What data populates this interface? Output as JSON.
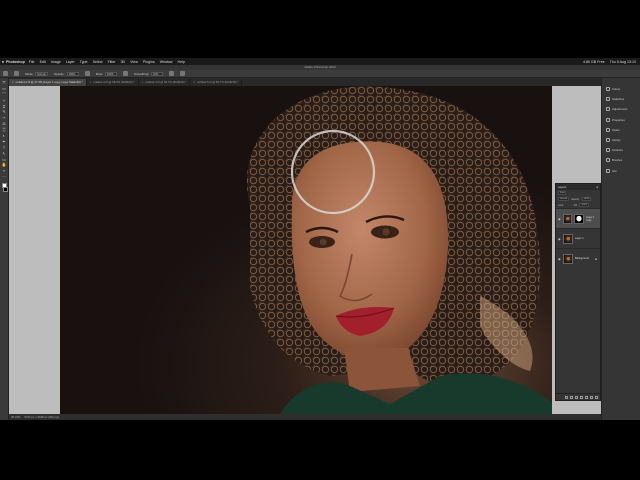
{
  "menubar": {
    "app_name": "Photoshop",
    "items": [
      "File",
      "Edit",
      "Image",
      "Layer",
      "Type",
      "Select",
      "Filter",
      "3D",
      "View",
      "Plugins",
      "Window",
      "Help"
    ],
    "status_right": [
      "4.80 GB Free",
      "Thu 8 Aug  13:10"
    ]
  },
  "window": {
    "title": "Adobe Photoshop 2024"
  },
  "options": {
    "mode_label": "Mode:",
    "mode_value": "Normal",
    "opacity_label": "Opacity:",
    "opacity_value": "100%",
    "flow_label": "Flow:",
    "flow_value": "100%",
    "smoothing_label": "Smoothing:",
    "smoothing_value": "10%"
  },
  "tabs": [
    {
      "label": "untitled-2.tif @ 47.3% (Layer 1 copy, Layer Mask/16) *",
      "active": true
    },
    {
      "label": "untitled-3.tif @ 58.3% (RGB/16) *",
      "active": false
    },
    {
      "label": "untitled-4.tif @ 56.7% (RGB/16) *",
      "active": false
    },
    {
      "label": "untitled-5.tif @ 56.7% (RGB/16) *",
      "active": false
    }
  ],
  "tools": [
    "⤧",
    "▭",
    "⌒",
    "✧",
    "⌗",
    "✎",
    "✑",
    "⎌",
    "▒",
    "◐",
    "✒",
    "T",
    "↖",
    "▭",
    "✋",
    "⌕",
    "⋯"
  ],
  "statusbar": {
    "zoom": "45.33%",
    "doc": "5472 px x 3648 px (300 ppi)"
  },
  "panels": {
    "items": [
      {
        "label": "Colour",
        "icon": "colour-panel-icon"
      },
      {
        "label": "Swatches",
        "icon": "swatches-panel-icon"
      },
      {
        "label": "Adjustments",
        "icon": "adjustments-panel-icon"
      },
      {
        "label": "Properties",
        "icon": "properties-panel-icon"
      },
      {
        "label": "Styles",
        "icon": "styles-panel-icon"
      },
      {
        "label": "History",
        "icon": "history-panel-icon"
      },
      {
        "label": "Libraries",
        "icon": "libraries-panel-icon"
      },
      {
        "label": "Brushes",
        "icon": "brushes-panel-icon"
      },
      {
        "label": "Info",
        "icon": "info-panel-icon"
      }
    ]
  },
  "layers_panel": {
    "title": "Layers",
    "kind_label": "Kind",
    "blend_mode": "Normal",
    "opacity_label": "Opacity:",
    "opacity_value": "100%",
    "lock_label": "Lock:",
    "fill_label": "Fill:",
    "fill_value": "100%",
    "layers": [
      {
        "name": "Layer 1 copy",
        "has_mask": true,
        "selected": true,
        "locked": false
      },
      {
        "name": "Layer 1",
        "has_mask": false,
        "selected": false,
        "locked": false
      },
      {
        "name": "Background",
        "has_mask": false,
        "selected": false,
        "locked": true
      }
    ]
  }
}
